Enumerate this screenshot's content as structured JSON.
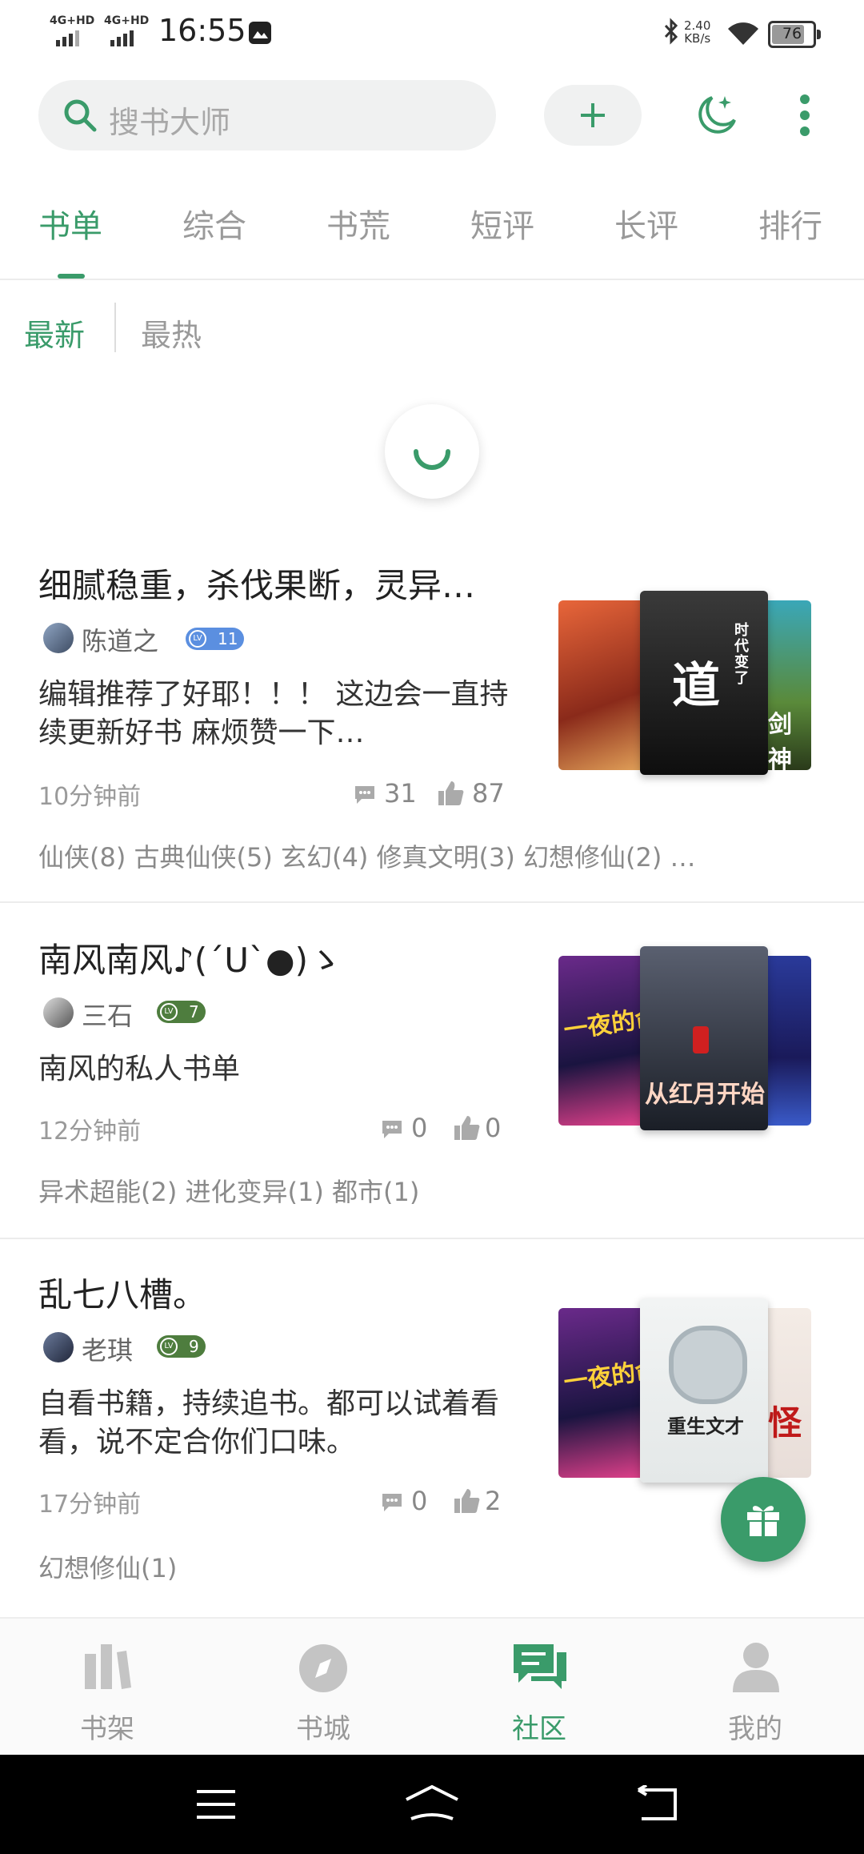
{
  "status_bar": {
    "network_1": "4G+HD",
    "network_2": "4G+HD",
    "time": "16:55",
    "speed_value": "2.40",
    "speed_unit": "KB/s",
    "battery": "76"
  },
  "search": {
    "placeholder": "搜书大师"
  },
  "tabs": [
    {
      "label": "书单"
    },
    {
      "label": "综合"
    },
    {
      "label": "书荒"
    },
    {
      "label": "短评"
    },
    {
      "label": "长评"
    },
    {
      "label": "排行"
    }
  ],
  "sub_tabs": [
    {
      "label": "最新"
    },
    {
      "label": "最热"
    }
  ],
  "items": [
    {
      "title": "细腻稳重，杀伐果断，灵异…",
      "user": "陈道之",
      "level": "11",
      "desc": "编辑推荐了好耶！！！ 这边会一直持续更新好书 麻烦赞一下…",
      "time": "10分钟前",
      "comments": "31",
      "likes": "87",
      "tags": "仙侠(8) 古典仙侠(5) 玄幻(4) 修真文明(3) 幻想修仙(2) …",
      "cover_texts": [
        "道",
        "时代变了",
        "剑神"
      ]
    },
    {
      "title": "南风南风♪(´U`●)ゝ",
      "user": "三石",
      "level": "7",
      "desc": "南风的私人书单",
      "time": "12分钟前",
      "comments": "0",
      "likes": "0",
      "tags": "异术超能(2) 进化变异(1) 都市(1)",
      "cover_texts": [
        "一夜的命",
        "从红月开始"
      ]
    },
    {
      "title": "乱七八槽。",
      "user": "老琪",
      "level": "9",
      "desc": "自看书籍，持续追书。都可以试着看看，说不定合你们口味。",
      "time": "17分钟前",
      "comments": "0",
      "likes": "2",
      "tags": "幻想修仙(1)",
      "cover_texts": [
        "一夜的命",
        "重生文才",
        "怪"
      ]
    }
  ],
  "bottom_nav": [
    {
      "label": "书架"
    },
    {
      "label": "书城"
    },
    {
      "label": "社区"
    },
    {
      "label": "我的"
    }
  ],
  "colors": {
    "accent": "#3a9b6a",
    "level_blue": "#5b8fe0"
  }
}
